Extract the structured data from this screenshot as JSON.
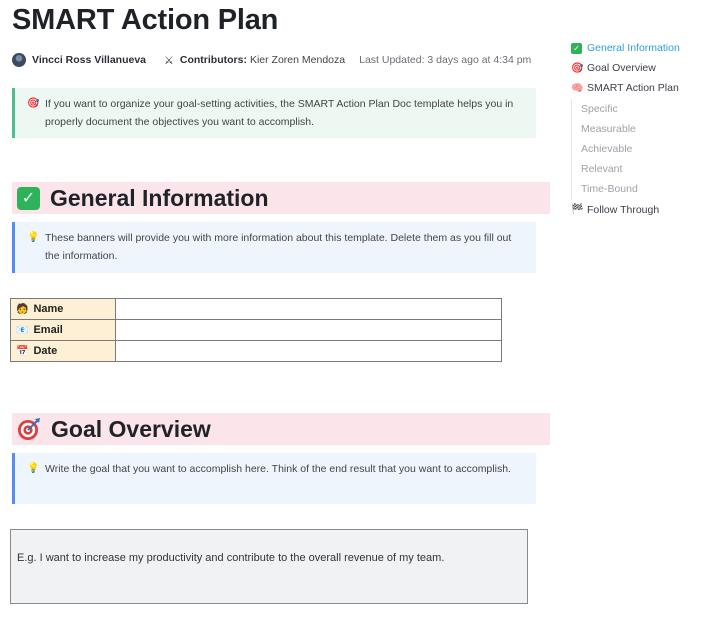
{
  "title": "SMART Action Plan",
  "meta": {
    "author": "Vincci Ross Villanueva",
    "contributors_label": "Contributors:",
    "contributors": "Kier Zoren Mendoza",
    "last_updated": "Last Updated: 3 days ago at 4:34 pm"
  },
  "intro_banner": "If you want to organize your goal-setting activities, the SMART Action Plan Doc template helps you in properly document the objectives you want to accomplish.",
  "sections": {
    "general": {
      "title": "General Information",
      "icon": "check-box-icon",
      "banner": "These banners will provide you with more information about this template. Delete them as you fill out the information.",
      "table": [
        {
          "label": "Name",
          "icon": "person-icon",
          "value": ""
        },
        {
          "label": "Email",
          "icon": "envelope-icon",
          "value": ""
        },
        {
          "label": "Date",
          "icon": "calendar-icon",
          "value": ""
        }
      ]
    },
    "goal": {
      "title": "Goal Overview",
      "icon": "target-icon",
      "banner": "Write the goal that you want to accomplish here. Think of the end result that you want to accomplish.",
      "example": "E.g. I want to increase my productivity and contribute to the overall revenue of my team."
    }
  },
  "toc": {
    "items": [
      {
        "label": "General Information",
        "icon": "check-box-icon",
        "active": true
      },
      {
        "label": "Goal Overview",
        "icon": "target-icon"
      },
      {
        "label": "SMART Action Plan",
        "icon": "brain-icon"
      },
      {
        "label": "Specific",
        "sub": true
      },
      {
        "label": "Measurable",
        "sub": true
      },
      {
        "label": "Achievable",
        "sub": true
      },
      {
        "label": "Relevant",
        "sub": true
      },
      {
        "label": "Time-Bound",
        "sub": true
      },
      {
        "label": "Follow Through",
        "icon": "checkered-flag-icon"
      }
    ]
  },
  "colors": {
    "section_header_bg": "#fbe4ea",
    "green_banner_bg": "#ecf8f1",
    "blue_banner_bg": "#eef5fd",
    "table_label_bg": "#fdf0d5",
    "toc_active": "#2f9fd6"
  }
}
